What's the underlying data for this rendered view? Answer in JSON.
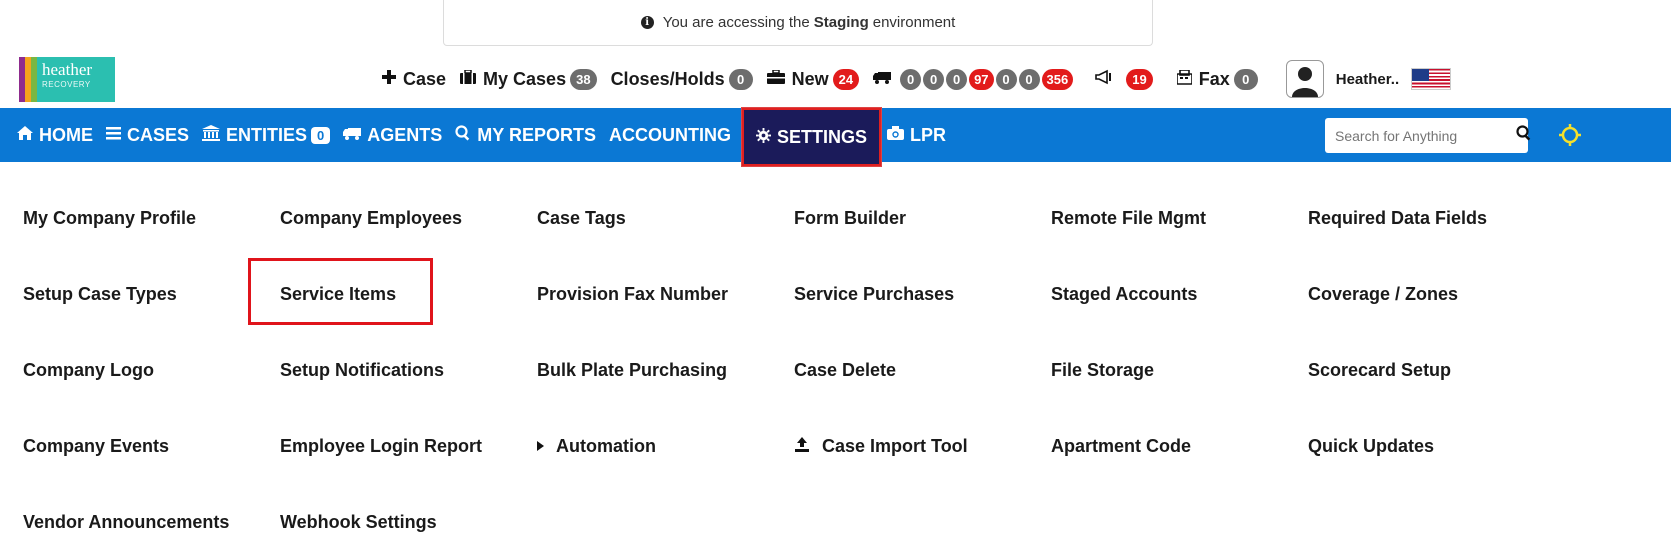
{
  "banner": {
    "prefix": "You are accessing the",
    "env": "Staging",
    "suffix": "environment"
  },
  "logo": {
    "line1": "heather",
    "line2": "RECOVERY"
  },
  "topbar": {
    "new_case": "Case",
    "my_cases": "My Cases",
    "my_cases_count": "38",
    "closes_holds": "Closes/Holds",
    "closes_holds_count": "0",
    "new": "New",
    "new_count": "24",
    "truck_counts": [
      "0",
      "0",
      "0",
      "97",
      "0",
      "0",
      "356"
    ],
    "announcements_count": "19",
    "fax": "Fax",
    "fax_count": "0",
    "user_name": "Heather.."
  },
  "nav": {
    "home": "HOME",
    "cases": "CASES",
    "entities": "ENTITIES",
    "entities_count": "0",
    "agents": "AGENTS",
    "my_reports": "MY REPORTS",
    "accounting": "ACCOUNTING",
    "settings": "SETTINGS",
    "lpr": "LPR",
    "search_placeholder": "Search for Anything"
  },
  "settings_menu": [
    [
      "My Company Profile",
      "Company Employees",
      "Case Tags",
      "Form Builder",
      "Remote File Mgmt",
      "Required Data Fields"
    ],
    [
      "Setup Case Types",
      "Service Items",
      "Provision Fax Number",
      "Service Purchases",
      "Staged Accounts",
      "Coverage / Zones"
    ],
    [
      "Company Logo",
      "Setup Notifications",
      "Bulk Plate Purchasing",
      "Case Delete",
      "File Storage",
      "Scorecard Setup"
    ],
    [
      "Company Events",
      "Employee Login Report",
      "Automation",
      "Case Import Tool",
      "Apartment Code",
      "Quick Updates"
    ],
    [
      "Vendor Announcements",
      "Webhook Settings"
    ]
  ],
  "colors": {
    "nav_blue": "#0b78d4",
    "settings_active": "#1b1b5a",
    "highlight_red": "#e0141b",
    "badge_red": "#e21b1b",
    "badge_gray": "#6d6d6d"
  }
}
